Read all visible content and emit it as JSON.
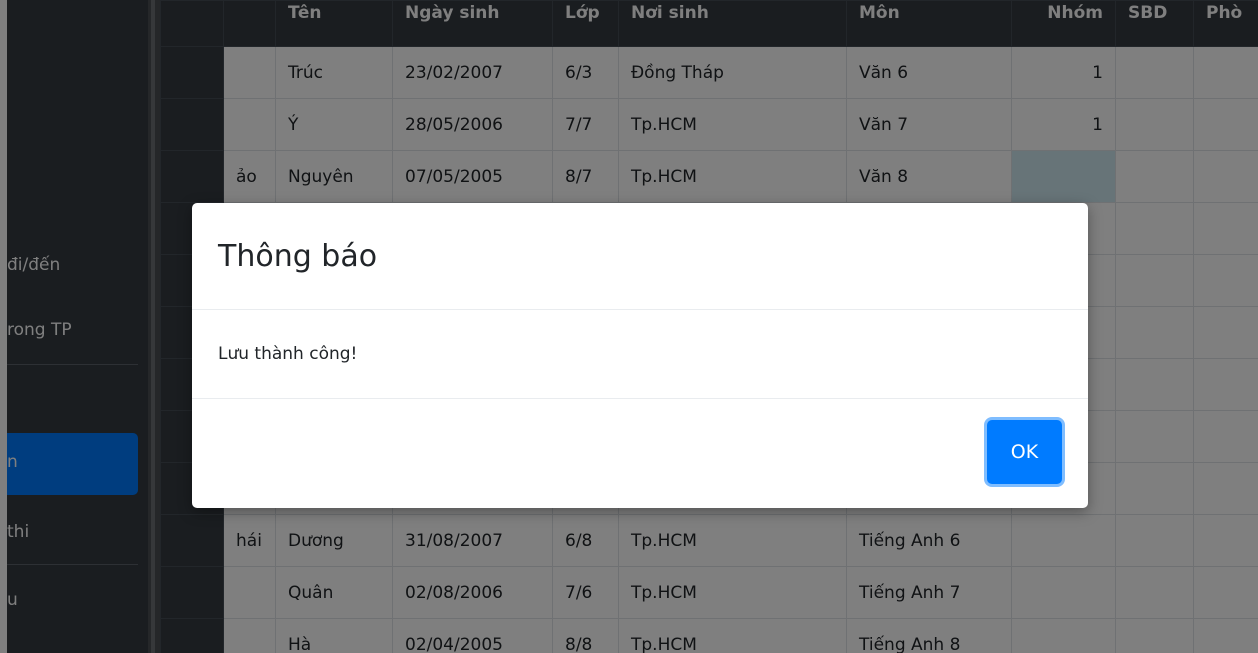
{
  "sidebar": {
    "items": [
      {
        "label": "đi/đến"
      },
      {
        "label": "rong TP"
      },
      {
        "label": "n"
      },
      {
        "label": "thi"
      },
      {
        "label": "u"
      }
    ]
  },
  "table": {
    "headers": [
      "Tên",
      "Ngày sinh",
      "Lớp",
      "Nơi sinh",
      "Môn",
      "Nhóm",
      "SBD",
      "Phò"
    ],
    "rows": [
      {
        "ho": "",
        "ten": "Trúc",
        "ngay": "23/02/2007",
        "lop": "6/3",
        "noi": "Đồng Tháp",
        "mon": "Văn 6",
        "nhom": "1"
      },
      {
        "ho": "",
        "ten": "Ý",
        "ngay": "28/05/2006",
        "lop": "7/7",
        "noi": "Tp.HCM",
        "mon": "Văn 7",
        "nhom": "1"
      },
      {
        "ho": "ảo",
        "ten": "Nguyên",
        "ngay": "07/05/2005",
        "lop": "8/7",
        "noi": "Tp.HCM",
        "mon": "Văn 8",
        "nhom": ""
      },
      {
        "ho": "",
        "ten": "",
        "ngay": "",
        "lop": "",
        "noi": "",
        "mon": "",
        "nhom": ""
      },
      {
        "ho": "",
        "ten": "",
        "ngay": "",
        "lop": "",
        "noi": "",
        "mon": "",
        "nhom": ""
      },
      {
        "ho": "",
        "ten": "",
        "ngay": "",
        "lop": "",
        "noi": "",
        "mon": "",
        "nhom": ""
      },
      {
        "ho": "",
        "ten": "",
        "ngay": "",
        "lop": "",
        "noi": "",
        "mon": "",
        "nhom": ""
      },
      {
        "ho": "",
        "ten": "",
        "ngay": "",
        "lop": "",
        "noi": "",
        "mon": "",
        "nhom": ""
      },
      {
        "ho": "",
        "ten": "",
        "ngay": "",
        "lop": "",
        "noi": "",
        "mon": "",
        "nhom": ""
      },
      {
        "ho": "hái",
        "ten": "Dương",
        "ngay": "31/08/2007",
        "lop": "6/8",
        "noi": "Tp.HCM",
        "mon": "Tiếng Anh 6",
        "nhom": ""
      },
      {
        "ho": "",
        "ten": "Quân",
        "ngay": "02/08/2006",
        "lop": "7/6",
        "noi": "Tp.HCM",
        "mon": "Tiếng Anh 7",
        "nhom": ""
      },
      {
        "ho": "",
        "ten": "Hà",
        "ngay": "02/04/2005",
        "lop": "8/8",
        "noi": "Tp.HCM",
        "mon": "Tiếng Anh 8",
        "nhom": ""
      }
    ]
  },
  "modal": {
    "title": "Thông báo",
    "message": "Lưu thành công!",
    "ok_label": "OK"
  },
  "colors": {
    "primary": "#007bff",
    "sidebar": "#343a40"
  }
}
